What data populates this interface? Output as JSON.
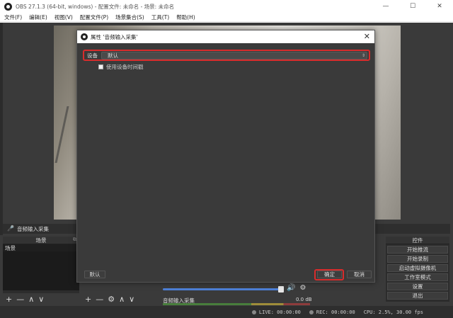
{
  "window": {
    "title": "OBS 27.1.3 (64-bit, windows) - 配置文件: 未命名 - 场景: 未命名",
    "minimize": "—",
    "maximize": "☐",
    "close": "✕"
  },
  "menu": [
    "文件(F)",
    "编辑(E)",
    "视图(V)",
    "配置文件(P)",
    "场景集合(S)",
    "工具(T)",
    "帮助(H)"
  ],
  "audio_source_bar": {
    "label": "音频输入采集"
  },
  "scenes_dock": {
    "title": "场景",
    "items": [
      "场景"
    ]
  },
  "toolbars": {
    "add": "+",
    "remove": "—",
    "gear": "⚙",
    "up": "∧",
    "down": "∨"
  },
  "mixer": {
    "label": "音频输入采集",
    "db": "0.0 dB",
    "speaker": "🔊",
    "gear": "⚙"
  },
  "controls": {
    "title": "控件",
    "buttons": [
      "开始推流",
      "开始录制",
      "启动虚拟摄像机",
      "工作室模式",
      "设置",
      "退出"
    ]
  },
  "status": {
    "live": "LIVE: 00:00:00",
    "rec": "REC: 00:00:00",
    "cpu": "CPU: 2.5%, 30.00 fps"
  },
  "dialog": {
    "title": "属性 '音频输入采集'",
    "close": "✕",
    "device_label": "设备",
    "device_value": "默认",
    "use_timestamp": "使用设备时间戳",
    "btn_default": "默认",
    "btn_ok": "确定",
    "btn_cancel": "取消"
  }
}
